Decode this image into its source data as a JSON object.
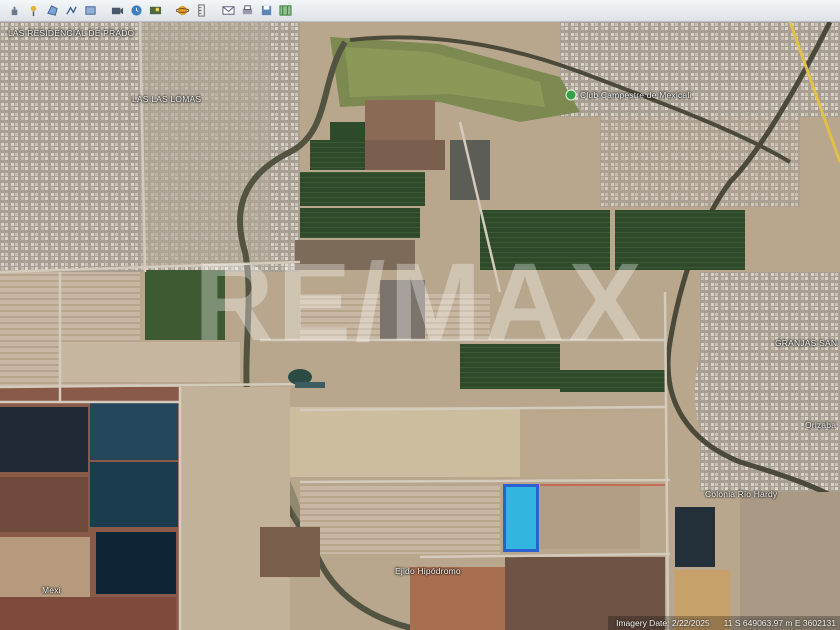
{
  "toolbar": {
    "icons": [
      "hand-tool-icon",
      "add-placemark-icon",
      "add-polygon-icon",
      "add-path-icon",
      "add-overlay-icon",
      "record-tour-icon",
      "historical-imagery-icon",
      "sun-icon",
      "planets-icon",
      "ruler-icon",
      "email-icon",
      "print-icon",
      "save-image-icon",
      "view-in-maps-icon"
    ]
  },
  "map": {
    "labels": {
      "residencial": "LAS RESIDENCIAL DE PRADO",
      "lomas": "LAS LAS LOMAS",
      "club": "Club Campestre de Mexicali",
      "lagrasas": "GRANJAS SAN",
      "orizaba": "Orizaba",
      "colonia": "Colonia Rio Hardy",
      "ejido": "Ejido Hipódromo",
      "bottomleft": "Mexi"
    },
    "watermark": "RE/MAX",
    "marker_color": "#27b8e6",
    "marker_border": "#1f5bd8"
  },
  "status": {
    "imagery_date": "Imagery Date: 2/22/2025",
    "coordinates": "11 S 649063.97 m E 3602131"
  }
}
